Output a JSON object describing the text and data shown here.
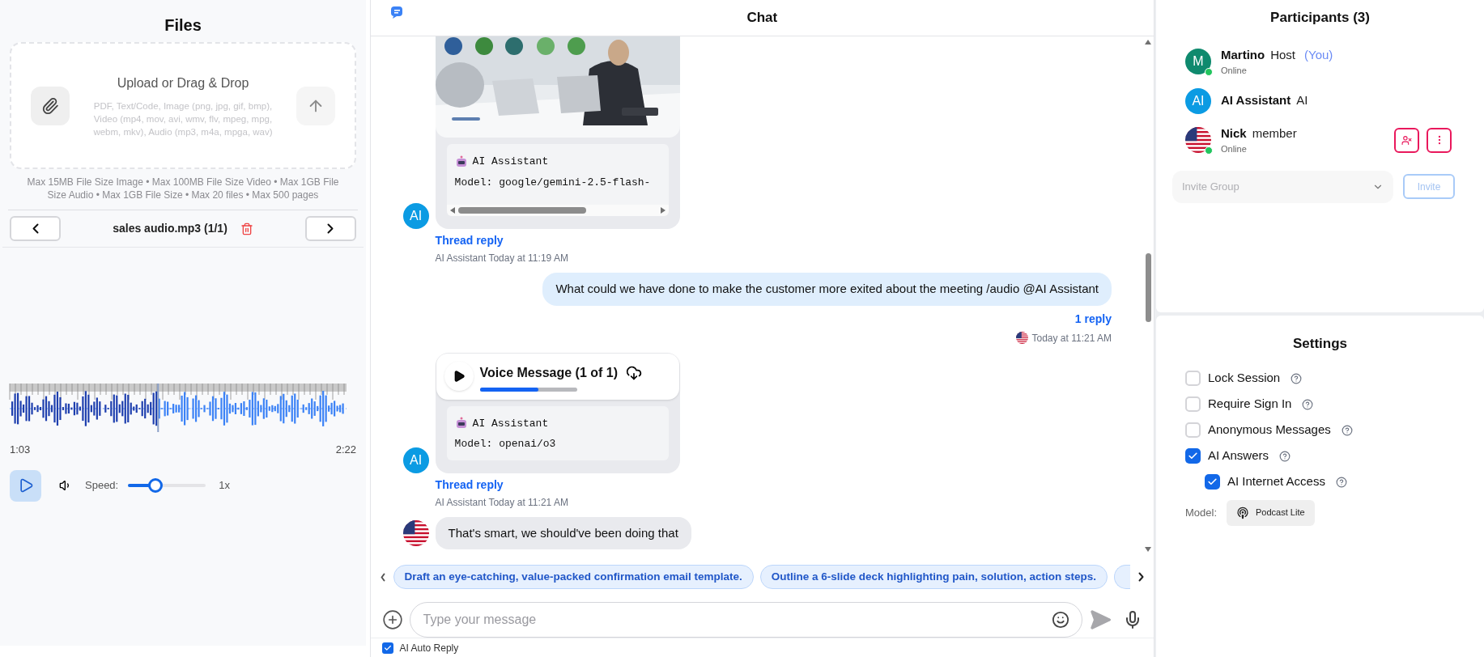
{
  "files": {
    "title": "Files",
    "upload": {
      "title": "Upload or Drag & Drop",
      "formats": "PDF, Text/Code, Image (png, jpg, gif, bmp), Video (mp4, mov, avi, wmv, flv, mpeg, mpg, webm, mkv), Audio (mp3, m4a, mpga, wav)"
    },
    "limits": "Max 15MB File Size Image • Max 100MB File Size Video • Max 1GB File Size Audio • Max 1GB File Size • Max 20 files • Max 500 pages",
    "current_file": "sales audio.mp3 (1/1)",
    "player": {
      "level": 0.44,
      "elapsed": "1:03",
      "duration": "2:22",
      "speed_label": "Speed:",
      "speed": {
        "level": 0.35
      },
      "speed_reading": "1x"
    }
  },
  "chat": {
    "title": "Chat",
    "messages": [
      {
        "kind": "ai_image",
        "avatar": "AI",
        "card_name": "AI Assistant",
        "model": "Model: google/gemini-2.5-flash-",
        "thread": "Thread reply",
        "meta": "AI Assistant Today at 11:19 AM"
      },
      {
        "kind": "own",
        "text": "What could we have done to make the customer more exited about the meeting /audio @AI Assistant",
        "replies": "1 reply",
        "meta": "Today at 11:21 AM"
      },
      {
        "kind": "ai_voice",
        "avatar": "AI",
        "title": "Voice Message (1 of 1)",
        "level": 0.6,
        "card_name": "AI Assistant",
        "model": "Model: openai/o3",
        "thread": "Thread reply",
        "meta": "AI Assistant Today at 11:21 AM"
      },
      {
        "kind": "member",
        "text": "That's smart, we should've been doing that"
      }
    ],
    "suggestions": [
      "Draft an eye-catching, value-packed confirmation email template.",
      "Outline a 6-slide deck highlighting pain, solution, action steps."
    ],
    "input": {
      "placeholder": "Type your message"
    },
    "auto_reply": {
      "label": "AI Auto Reply",
      "checked": true
    }
  },
  "participants": {
    "title": "Participants (3)",
    "items": [
      {
        "avatar": {
          "kind": "letter",
          "text": "M",
          "color": "#0f8a6e"
        },
        "name": "Martino",
        "role": "Host",
        "you": "(You)",
        "status": "Online",
        "online": true,
        "actions": false
      },
      {
        "avatar": {
          "kind": "letter",
          "text": "AI",
          "color": "#0b9be3"
        },
        "name": "AI Assistant",
        "role": "AI",
        "online": false,
        "actions": false
      },
      {
        "avatar": {
          "kind": "flag"
        },
        "name": "Nick",
        "role": "member",
        "status": "Online",
        "online": true,
        "actions": true
      }
    ],
    "invite": {
      "placeholder": "Invite Group",
      "button": "Invite",
      "disabled": true
    }
  },
  "settings": {
    "title": "Settings",
    "options": [
      {
        "label": "Lock Session",
        "checked": false
      },
      {
        "label": "Require Sign In",
        "checked": false
      },
      {
        "label": "Anonymous Messages",
        "checked": false
      },
      {
        "label": "AI Answers",
        "checked": true,
        "children": [
          {
            "label": "AI Internet Access",
            "checked": true
          }
        ]
      }
    ],
    "model_label": "Model:",
    "model": "Podcast Lite"
  }
}
